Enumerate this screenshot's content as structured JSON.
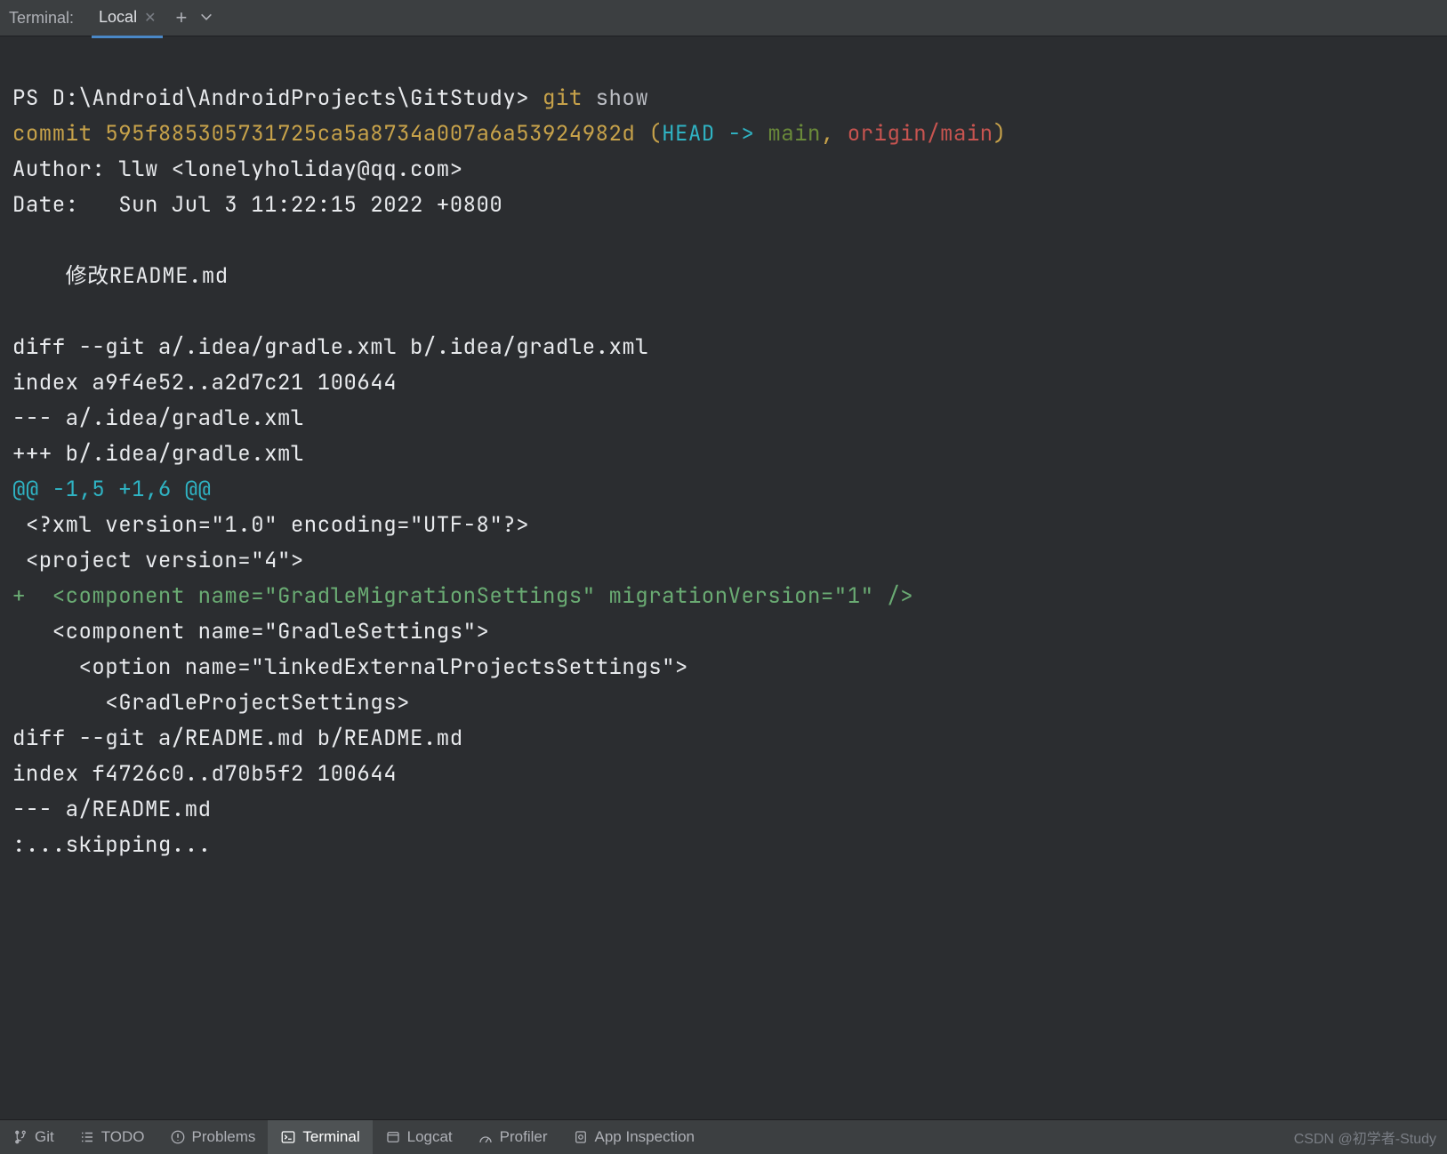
{
  "tabStrip": {
    "label": "Terminal:",
    "activeTab": "Local"
  },
  "prompt": {
    "ps": "PS ",
    "path": "D:\\Android\\AndroidProjects\\GitStudy",
    "gt": "> ",
    "cmd": "git",
    "arg": " show"
  },
  "commit": {
    "word": "commit ",
    "hash": "595f885305731725ca5a8734a007a6a53924982d",
    "space": " ",
    "lp": "(",
    "head": "HEAD -> ",
    "branch": "main",
    "comma": ", ",
    "remote": "origin/main",
    "rp": ")"
  },
  "author": "Author: llw <lonelyholiday@qq.com>",
  "date": "Date:   Sun Jul 3 11:22:15 2022 +0800",
  "blank": "",
  "msg": "    修改README.md",
  "diff1_line1": "diff --git a/.idea/gradle.xml b/.idea/gradle.xml",
  "diff1_line2": "index a9f4e52..a2d7c21 100644",
  "diff1_line3": "--- a/.idea/gradle.xml",
  "diff1_line4": "+++ b/.idea/gradle.xml",
  "hunk": "@@ -1,5 +1,6 @@",
  "x1": " <?xml version=\"1.0\" encoding=\"UTF-8\"?>",
  "x2": " <project version=\"4\">",
  "xadd": "+  <component name=\"GradleMigrationSettings\" migrationVersion=\"1\" />",
  "x3": "   <component name=\"GradleSettings\">",
  "x4": "     <option name=\"linkedExternalProjectsSettings\">",
  "x5": "       <GradleProjectSettings>",
  "diff2_line1": "diff --git a/README.md b/README.md",
  "diff2_line2": "index f4726c0..d70b5f2 100644",
  "diff2_line3": "--- a/README.md",
  "skip": ":...skipping...",
  "bottom": {
    "git": "Git",
    "todo": "TODO",
    "problems": "Problems",
    "terminal": "Terminal",
    "logcat": "Logcat",
    "profiler": "Profiler",
    "appinsp": "App Inspection"
  },
  "watermark": "CSDN @初学者-Study"
}
